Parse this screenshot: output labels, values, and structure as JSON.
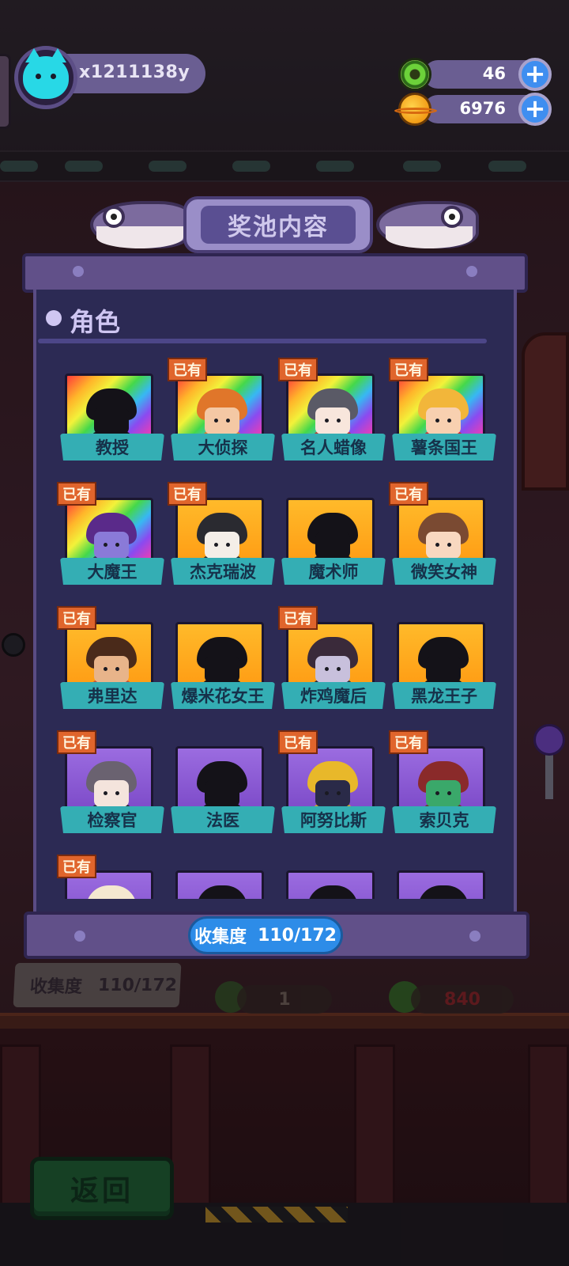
{
  "player": {
    "name": "x1211138y",
    "avatar_icon": "cat-face-icon",
    "avatar_color": "#28d8e6"
  },
  "currencies": [
    {
      "icon": "donut-icon",
      "value": "46",
      "add_icon": "plus-icon"
    },
    {
      "icon": "planet-coin-icon",
      "value": "6976",
      "add_icon": "plus-icon"
    }
  ],
  "modal": {
    "title": "奖池内容",
    "section_title": "角色",
    "owned_tag": "已有",
    "collection_label": "收集度",
    "collection_value": "110/172",
    "characters": [
      {
        "name": "教授",
        "owned": false,
        "frame": "rainbow",
        "silhouette": true,
        "hair": "#141218",
        "face": "#141218",
        "body": "#141218"
      },
      {
        "name": "大侦探",
        "owned": true,
        "frame": "rainbow",
        "silhouette": false,
        "hair": "#e0762a",
        "face": "#f4c8a4",
        "body": "#e07a2a"
      },
      {
        "name": "名人蜡像",
        "owned": true,
        "frame": "rainbow",
        "silhouette": false,
        "hair": "#5a5a66",
        "face": "#f8e6dc",
        "body": "#c23a2a"
      },
      {
        "name": "薯条国王",
        "owned": true,
        "frame": "rainbow",
        "silhouette": false,
        "hair": "#f2b63a",
        "face": "#f8d0b0",
        "body": "#d82a2a"
      },
      {
        "name": "大魔王",
        "owned": true,
        "frame": "rainbow",
        "silhouette": false,
        "hair": "#5a2a8a",
        "face": "#8a7ad8",
        "body": "#3a2a5a"
      },
      {
        "name": "杰克瑞波",
        "owned": true,
        "frame": "gold",
        "silhouette": false,
        "hair": "#2a2a30",
        "face": "#f4eee8",
        "body": "#2a2a30"
      },
      {
        "name": "魔术师",
        "owned": false,
        "frame": "gold",
        "silhouette": true,
        "hair": "#141218",
        "face": "#141218",
        "body": "#141218"
      },
      {
        "name": "微笑女神",
        "owned": true,
        "frame": "gold",
        "silhouette": false,
        "hair": "#7a4a32",
        "face": "#f8d8c0",
        "body": "#e8a42a"
      },
      {
        "name": "弗里达",
        "owned": true,
        "frame": "gold",
        "silhouette": false,
        "hair": "#4a2a1a",
        "face": "#e8b48a",
        "body": "#c0503a"
      },
      {
        "name": "爆米花女王",
        "owned": false,
        "frame": "gold",
        "silhouette": true,
        "hair": "#141218",
        "face": "#141218",
        "body": "#141218"
      },
      {
        "name": "炸鸡魔后",
        "owned": true,
        "frame": "gold",
        "silhouette": false,
        "hair": "#3a2a3a",
        "face": "#c8c0dc",
        "body": "#2a2a3a"
      },
      {
        "name": "黑龙王子",
        "owned": false,
        "frame": "gold",
        "silhouette": true,
        "hair": "#141218",
        "face": "#141218",
        "body": "#141218"
      },
      {
        "name": "检察官",
        "owned": true,
        "frame": "purple",
        "silhouette": false,
        "hair": "#6a6270",
        "face": "#f4e4dc",
        "body": "#2a2230"
      },
      {
        "name": "法医",
        "owned": false,
        "frame": "purple",
        "silhouette": true,
        "hair": "#141218",
        "face": "#141218",
        "body": "#141218"
      },
      {
        "name": "阿努比斯",
        "owned": true,
        "frame": "purple",
        "silhouette": false,
        "hair": "#e8b82a",
        "face": "#2a2a48",
        "body": "#d8a42a"
      },
      {
        "name": "索贝克",
        "owned": true,
        "frame": "purple",
        "silhouette": false,
        "hair": "#8a2a2a",
        "face": "#3aa86a",
        "body": "#6a3a2a"
      },
      {
        "name": "",
        "owned": true,
        "frame": "purple",
        "silhouette": false,
        "hair": "#f4e8d0",
        "face": "#f8e0c8",
        "body": "#c08a5a"
      },
      {
        "name": "",
        "owned": false,
        "frame": "purple",
        "silhouette": true,
        "hair": "#141218",
        "face": "#141218",
        "body": "#141218"
      },
      {
        "name": "",
        "owned": false,
        "frame": "purple",
        "silhouette": true,
        "hair": "#141218",
        "face": "#141218",
        "body": "#141218"
      },
      {
        "name": "",
        "owned": false,
        "frame": "purple",
        "silhouette": true,
        "hair": "#141218",
        "face": "#141218",
        "body": "#141218"
      }
    ]
  },
  "background": {
    "collection_label": "收集度",
    "collection_value": "110/172",
    "item_count": "1",
    "price": "840",
    "return_button": "返回"
  },
  "colors": {
    "panel": "#2c2a54",
    "panel_frame": "#615089",
    "label_teal": "#34aeb4",
    "owned_orange": "#e0652c",
    "collect_blue": "#2d8ce8"
  }
}
